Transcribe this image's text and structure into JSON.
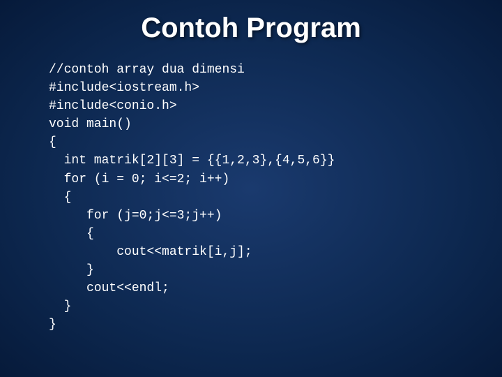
{
  "slide": {
    "title": "Contoh Program",
    "code_lines": [
      "//contoh array dua dimensi",
      "#include<iostream.h>",
      "#include<conio.h>",
      "void main()",
      "{",
      "  int matrik[2][3] = {{1,2,3},{4,5,6}}",
      "  for (i = 0; i<=2; i++)",
      "  {",
      "     for (j=0;j<=3;j++)",
      "     {",
      "         cout<<matrik[i,j];",
      "     }",
      "     cout<<endl;",
      "  }",
      "}"
    ]
  }
}
